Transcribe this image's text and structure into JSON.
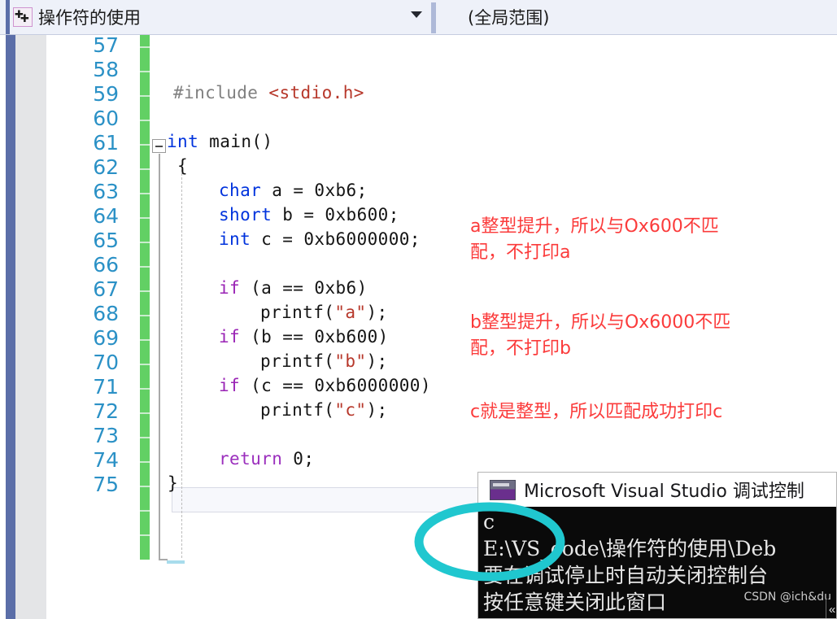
{
  "toolbar": {
    "project_icon": "cpp-file-icon",
    "project_name": "操作符的使用",
    "dropdown_icon": "chevron-down-icon",
    "scope_name": "(全局范围)"
  },
  "editor": {
    "fold_icon": "collapse-minus-icon",
    "line_numbers": [
      "57",
      "58",
      "59",
      "60",
      "61",
      "62",
      "63",
      "64",
      "65",
      "66",
      "67",
      "68",
      "69",
      "70",
      "71",
      "72",
      "73",
      "74",
      "75"
    ],
    "code_lines": [
      {
        "num": "57",
        "text": ""
      },
      {
        "num": "58",
        "text": ""
      },
      {
        "num": "59",
        "text": "#include <stdio.h>"
      },
      {
        "num": "60",
        "text": ""
      },
      {
        "num": "61",
        "text": "int main()"
      },
      {
        "num": "62",
        "text": "{"
      },
      {
        "num": "63",
        "text": "    char a = 0xb6;"
      },
      {
        "num": "64",
        "text": "    short b = 0xb600;"
      },
      {
        "num": "65",
        "text": "    int c = 0xb6000000;"
      },
      {
        "num": "66",
        "text": ""
      },
      {
        "num": "67",
        "text": "    if (a == 0xb6)"
      },
      {
        "num": "68",
        "text": "        printf(\"a\");"
      },
      {
        "num": "69",
        "text": "    if (b == 0xb600)"
      },
      {
        "num": "70",
        "text": "        printf(\"b\");"
      },
      {
        "num": "71",
        "text": "    if (c == 0xb6000000)"
      },
      {
        "num": "72",
        "text": "        printf(\"c\");"
      },
      {
        "num": "73",
        "text": ""
      },
      {
        "num": "74",
        "text": "    return 0;"
      },
      {
        "num": "75",
        "text": "}"
      }
    ],
    "tokens": {
      "include_directive": "#include",
      "include_header": "<stdio.h>",
      "kw_int": "int",
      "fn_main": " main()",
      "brace_open": "{",
      "kw_char": "char",
      "decl_a": " a = 0xb6;",
      "kw_short": "short",
      "decl_b": " b = 0xb600;",
      "kw_int2": "int",
      "decl_c": " c = 0xb6000000;",
      "kw_if": "if",
      "cond_a": " (a == 0xb6)",
      "cond_b": " (b == 0xb600)",
      "cond_c": " (c == 0xb6000000)",
      "call_open": "printf(",
      "str_a": "\"a\"",
      "str_b": "\"b\"",
      "str_c": "\"c\"",
      "call_close": ");",
      "kw_return": "return",
      "return_value": " 0;",
      "brace_close": "}"
    },
    "colors": {
      "keyword_blue": "#0033dd",
      "keyword_purple": "#9b2fbd",
      "string_red": "#b7382b",
      "line_number_blue": "#2b91c6",
      "change_bar_green": "#62d064",
      "annotation_red": "#fb3b3b",
      "accent_blue": "#5b6ea8",
      "teal_circle": "#20c7cf"
    }
  },
  "annotations": [
    {
      "id": "note-a",
      "text": "a整型提升，所以与Ox600不匹\n配，不打印a"
    },
    {
      "id": "note-b",
      "text": "b整型提升，所以与Ox6000不匹\n配，不打印b"
    },
    {
      "id": "note-c",
      "text": "c就是整型，所以匹配成功打印c"
    }
  ],
  "console": {
    "icon": "console-app-icon",
    "title": "Microsoft Visual Studio 调试控制",
    "output_lines": [
      "c",
      "E:\\VS_code\\操作符的使用\\Deb",
      "要在调试停止时自动关闭控制台",
      "按任意键关闭此窗口"
    ],
    "scroll_arrow": "«",
    "watermark": "CSDN @ich&du"
  }
}
